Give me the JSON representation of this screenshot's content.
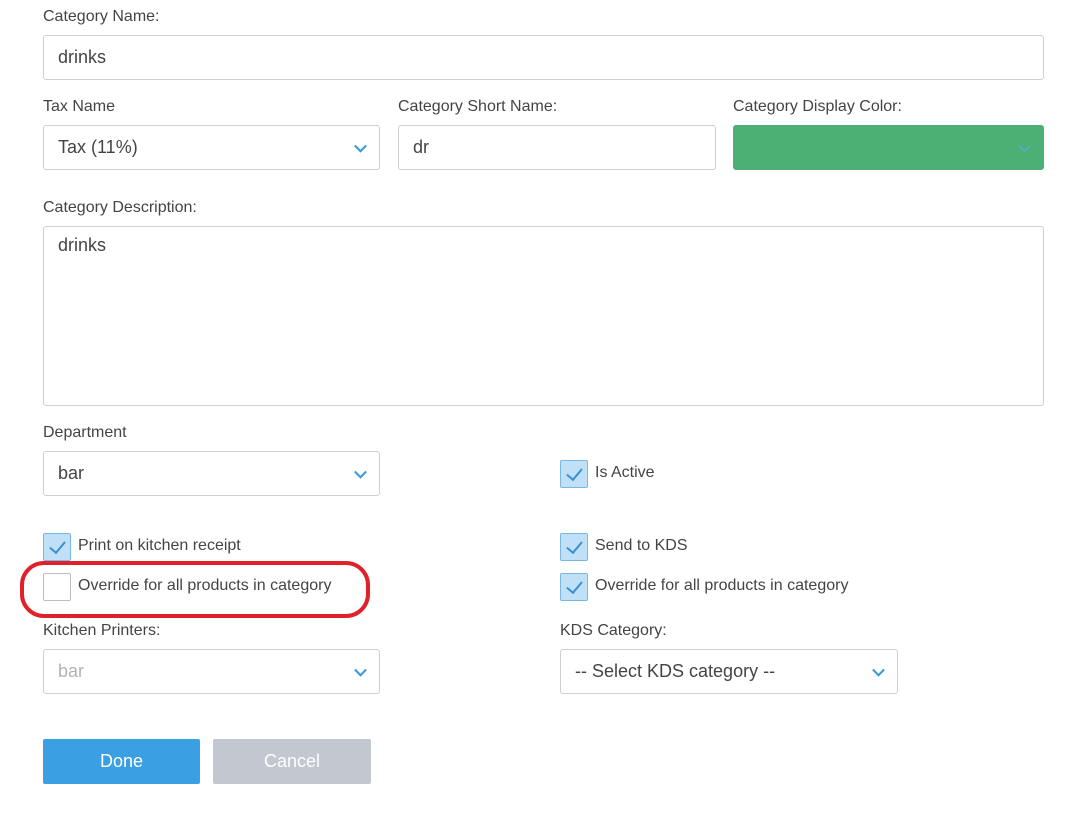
{
  "category_name": {
    "label": "Category Name:",
    "value": "drinks"
  },
  "tax": {
    "label": "Tax Name",
    "value": "Tax (11%)"
  },
  "short_name": {
    "label": "Category Short Name:",
    "value": "dr"
  },
  "display_color": {
    "label": "Category Display Color:",
    "color": "#4caf73"
  },
  "description": {
    "label": "Category Description:",
    "value": "drinks"
  },
  "department": {
    "label": "Department",
    "value": "bar"
  },
  "is_active": {
    "label": "Is Active",
    "checked": true
  },
  "print_kitchen": {
    "label": "Print on kitchen receipt",
    "checked": true
  },
  "print_override": {
    "label": "Override for all products in category",
    "checked": false
  },
  "send_kds": {
    "label": "Send to KDS",
    "checked": true
  },
  "kds_override": {
    "label": "Override for all products in category",
    "checked": true
  },
  "kitchen_printers": {
    "label": "Kitchen Printers:",
    "value": "bar"
  },
  "kds_category": {
    "label": "KDS Category:",
    "value": "-- Select KDS category --"
  },
  "buttons": {
    "done": "Done",
    "cancel": "Cancel"
  },
  "colors": {
    "accent": "#3aa0e3",
    "highlight": "#e0202a",
    "checkbox_fill": "#bfe0f7",
    "cancel_bg": "#c3c7cf"
  }
}
